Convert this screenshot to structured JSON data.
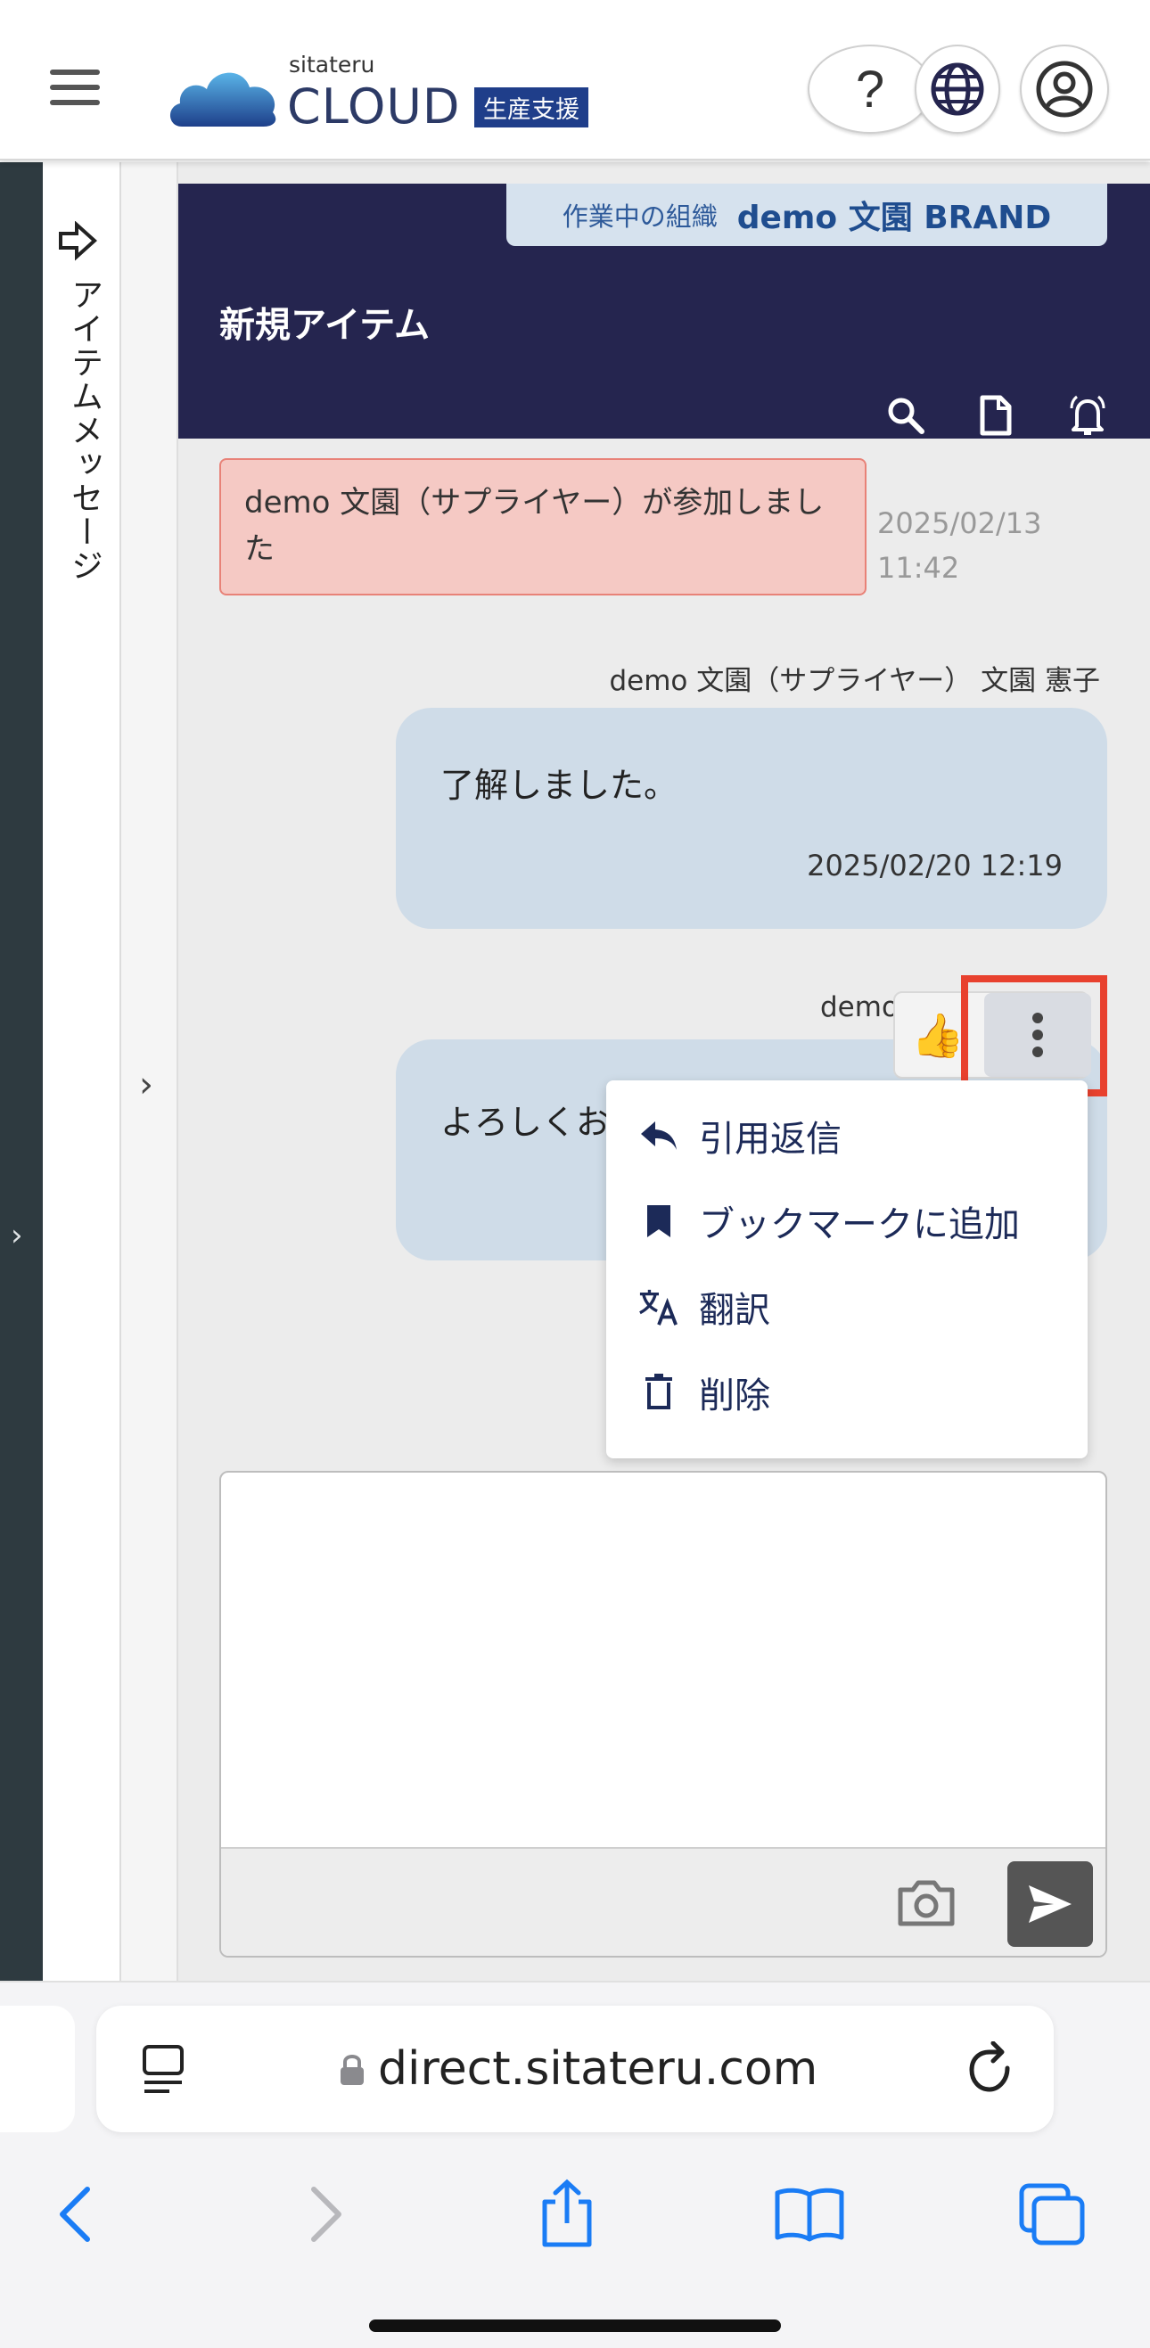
{
  "header": {
    "logo_small": "sitateru",
    "logo_big": "CLOUD",
    "logo_tag": "生産支援",
    "help_label": "?"
  },
  "sidebar": {
    "label": "アイテムメッセージ"
  },
  "main": {
    "org_label": "作業中の組織",
    "org_value": "demo 文園 BRAND",
    "page_title": "新規アイテム"
  },
  "messages": {
    "system_text": "demo 文園（サプライヤー）が参加しました",
    "system_time_date": "2025/02/13",
    "system_time_clock": "11:42",
    "msg1_sender": "demo 文園（サプライヤー） 文園 憲子",
    "msg1_text": "了解しました。",
    "msg1_time": "2025/02/20 12:19",
    "msg2_sender_partial": "demo",
    "msg2_text_partial": "よろしくお"
  },
  "reaction_bar": {
    "thumb": "👍"
  },
  "context_menu": {
    "items": [
      {
        "label": "引用返信",
        "icon": "reply-icon"
      },
      {
        "label": "ブックマークに追加",
        "icon": "bookmark-icon"
      },
      {
        "label": "翻訳",
        "icon": "translate-icon"
      },
      {
        "label": "削除",
        "icon": "trash-icon"
      }
    ]
  },
  "browser": {
    "url": "direct.sitateru.com"
  },
  "colors": {
    "brand_navy": "#25254f",
    "bubble": "#cfdce8",
    "system_bg": "#f5c9c4",
    "highlight": "#e8412e",
    "ios_blue": "#1a7cf5"
  }
}
